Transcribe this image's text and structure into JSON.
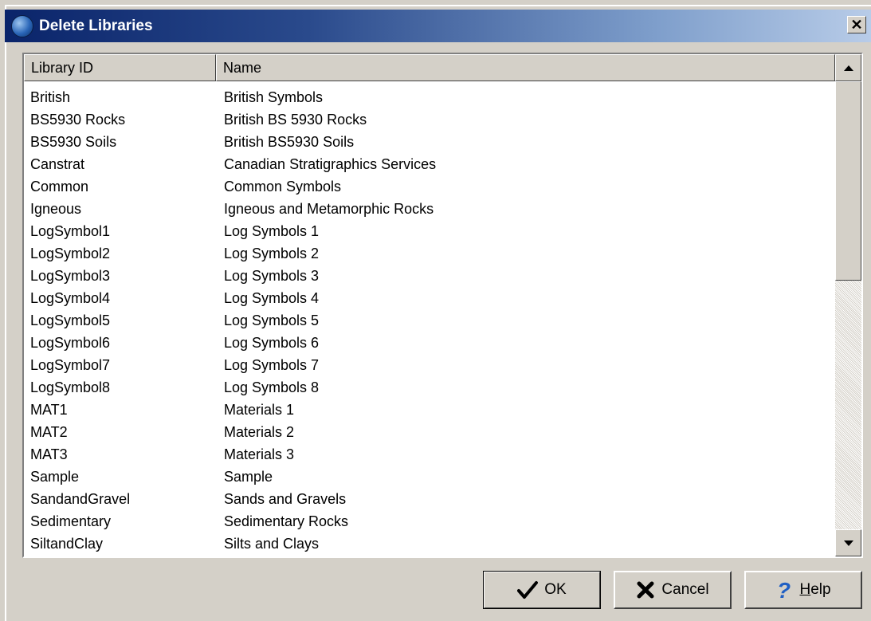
{
  "window": {
    "title": "Delete Libraries",
    "close_glyph": "✕"
  },
  "list": {
    "columns": [
      "Library ID",
      "Name"
    ],
    "rows": [
      {
        "id": "British",
        "name": "British Symbols"
      },
      {
        "id": "BS5930 Rocks",
        "name": "British BS 5930 Rocks"
      },
      {
        "id": "BS5930 Soils",
        "name": "British BS5930 Soils"
      },
      {
        "id": "Canstrat",
        "name": "Canadian Stratigraphics Services"
      },
      {
        "id": "Common",
        "name": "Common Symbols"
      },
      {
        "id": "Igneous",
        "name": "Igneous and Metamorphic  Rocks"
      },
      {
        "id": "LogSymbol1",
        "name": "Log Symbols 1"
      },
      {
        "id": "LogSymbol2",
        "name": "Log Symbols 2"
      },
      {
        "id": "LogSymbol3",
        "name": "Log Symbols 3"
      },
      {
        "id": "LogSymbol4",
        "name": "Log Symbols 4"
      },
      {
        "id": "LogSymbol5",
        "name": "Log Symbols 5"
      },
      {
        "id": "LogSymbol6",
        "name": "Log Symbols 6"
      },
      {
        "id": "LogSymbol7",
        "name": "Log Symbols 7"
      },
      {
        "id": "LogSymbol8",
        "name": "Log Symbols 8"
      },
      {
        "id": "MAT1",
        "name": "Materials 1"
      },
      {
        "id": "MAT2",
        "name": "Materials 2"
      },
      {
        "id": "MAT3",
        "name": "Materials 3"
      },
      {
        "id": "Sample",
        "name": "Sample"
      },
      {
        "id": "SandandGravel",
        "name": "Sands and Gravels"
      },
      {
        "id": "Sedimentary",
        "name": "Sedimentary Rocks"
      },
      {
        "id": "SiltandClay",
        "name": "Silts and Clays"
      }
    ]
  },
  "buttons": {
    "ok": {
      "label": "OK",
      "icon": "checkmark-icon"
    },
    "cancel": {
      "label": "Cancel",
      "icon": "x-mark-icon"
    },
    "help": {
      "label_underlined": "H",
      "label_rest": "elp",
      "icon": "question-mark-icon"
    }
  },
  "colors": {
    "title_start": "#0a246a",
    "title_end": "#b8cce8",
    "face": "#d4d0c8",
    "help_icon": "#1f5fc4",
    "cancel_icon": "#000000"
  }
}
